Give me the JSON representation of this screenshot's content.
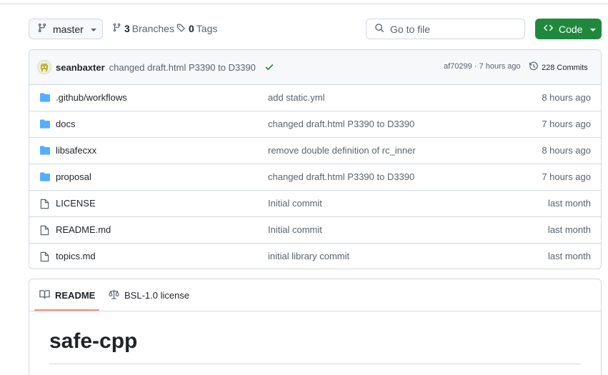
{
  "branch": {
    "name": "master"
  },
  "repo_meta": {
    "branches_count": "3",
    "branches_label": "Branches",
    "tags_count": "0",
    "tags_label": "Tags"
  },
  "search": {
    "placeholder": "Go to file"
  },
  "code_button": {
    "label": "Code"
  },
  "latest_commit": {
    "author": "seanbaxter",
    "message": "changed draft.html P3390 to D3390",
    "status": "success",
    "sha_time": "af70299 · 7 hours ago",
    "commits_label": "228 Commits"
  },
  "files": [
    {
      "type": "folder",
      "name": ".github/workflows",
      "message": "add static.yml",
      "time": "8 hours ago"
    },
    {
      "type": "folder",
      "name": "docs",
      "message": "changed draft.html P3390 to D3390",
      "time": "7 hours ago"
    },
    {
      "type": "folder",
      "name": "libsafecxx",
      "message": "remove double definition of rc_inner",
      "time": "8 hours ago"
    },
    {
      "type": "folder",
      "name": "proposal",
      "message": "changed draft.html P3390 to D3390",
      "time": "7 hours ago"
    },
    {
      "type": "file",
      "name": "LICENSE",
      "message": "Initial commit",
      "time": "last month"
    },
    {
      "type": "file",
      "name": "README.md",
      "message": "Initial commit",
      "time": "last month"
    },
    {
      "type": "file",
      "name": "topics.md",
      "message": "initial library commit",
      "time": "last month"
    }
  ],
  "readme": {
    "tabs": {
      "readme": "README",
      "license": "BSL-1.0 license"
    },
    "title": "safe-cpp"
  },
  "colors": {
    "accent_green": "#1f883d",
    "folder_blue": "#54aeff",
    "tab_underline": "#fd8c73"
  },
  "icons": {
    "branch": "git-branch-icon",
    "tag": "tag-icon",
    "search": "search-icon",
    "code": "code-icon",
    "check": "check-icon",
    "history": "history-icon",
    "folder": "folder-icon",
    "file": "file-icon",
    "book": "book-icon",
    "law": "law-icon"
  }
}
